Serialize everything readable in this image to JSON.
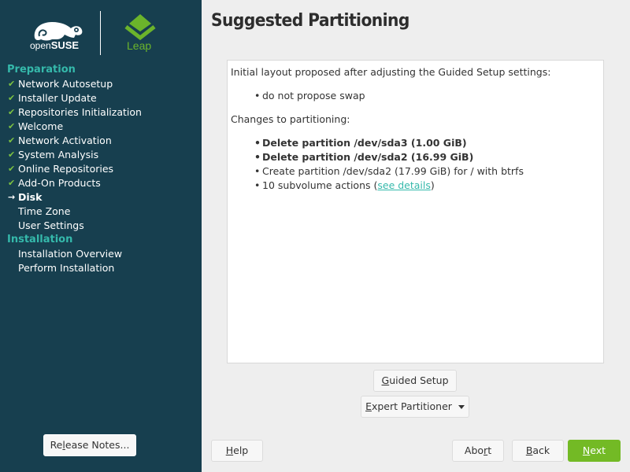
{
  "branding": {
    "distro_prefix": "open",
    "distro_name": "SUSE",
    "edition": "Leap",
    "colors": {
      "sidebar_bg": "#173f4f",
      "section_title": "#35b9ab",
      "check": "#7dc242",
      "accent_green": "#73ba25",
      "leap_green": "#6bb42b"
    }
  },
  "sidebar": {
    "sections": [
      {
        "title": "Preparation",
        "steps": [
          {
            "label": "Network Autosetup",
            "status": "done"
          },
          {
            "label": "Installer Update",
            "status": "done"
          },
          {
            "label": "Repositories Initialization",
            "status": "done"
          },
          {
            "label": "Welcome",
            "status": "done"
          },
          {
            "label": "Network Activation",
            "status": "done"
          },
          {
            "label": "System Analysis",
            "status": "done"
          },
          {
            "label": "Online Repositories",
            "status": "done"
          },
          {
            "label": "Add-On Products",
            "status": "done"
          },
          {
            "label": "Disk",
            "status": "current"
          },
          {
            "label": "Time Zone",
            "status": "pending"
          },
          {
            "label": "User Settings",
            "status": "pending"
          }
        ]
      },
      {
        "title": "Installation",
        "steps": [
          {
            "label": "Installation Overview",
            "status": "pending"
          },
          {
            "label": "Perform Installation",
            "status": "pending"
          }
        ]
      }
    ],
    "release_notes_button": {
      "pre": "Re",
      "accel": "l",
      "post": "ease Notes..."
    }
  },
  "main": {
    "title": "Suggested Partitioning",
    "intro": "Initial layout proposed after adjusting the Guided Setup settings:",
    "settings": [
      "do not propose swap"
    ],
    "changes_heading": "Changes to partitioning:",
    "changes": [
      {
        "text": "Delete partition /dev/sda3 (1.00 GiB)",
        "bold": true
      },
      {
        "text": "Delete partition /dev/sda2 (16.99 GiB)",
        "bold": true
      },
      {
        "text": "Create partition /dev/sda2 (17.99 GiB) for / with btrfs",
        "bold": false
      }
    ],
    "subvolume": {
      "pre": "10 subvolume actions (",
      "link": "see details",
      "post": ")"
    },
    "guided_setup_button": {
      "accel": "G",
      "post": "uided Setup"
    },
    "expert_partitioner_button": {
      "accel": "E",
      "post": "xpert Partitioner"
    }
  },
  "footer": {
    "help": {
      "accel": "H",
      "post": "elp"
    },
    "abort": {
      "pre": "Abo",
      "accel": "r",
      "post": "t"
    },
    "back": {
      "accel": "B",
      "post": "ack"
    },
    "next": {
      "accel": "N",
      "post": "ext"
    }
  }
}
